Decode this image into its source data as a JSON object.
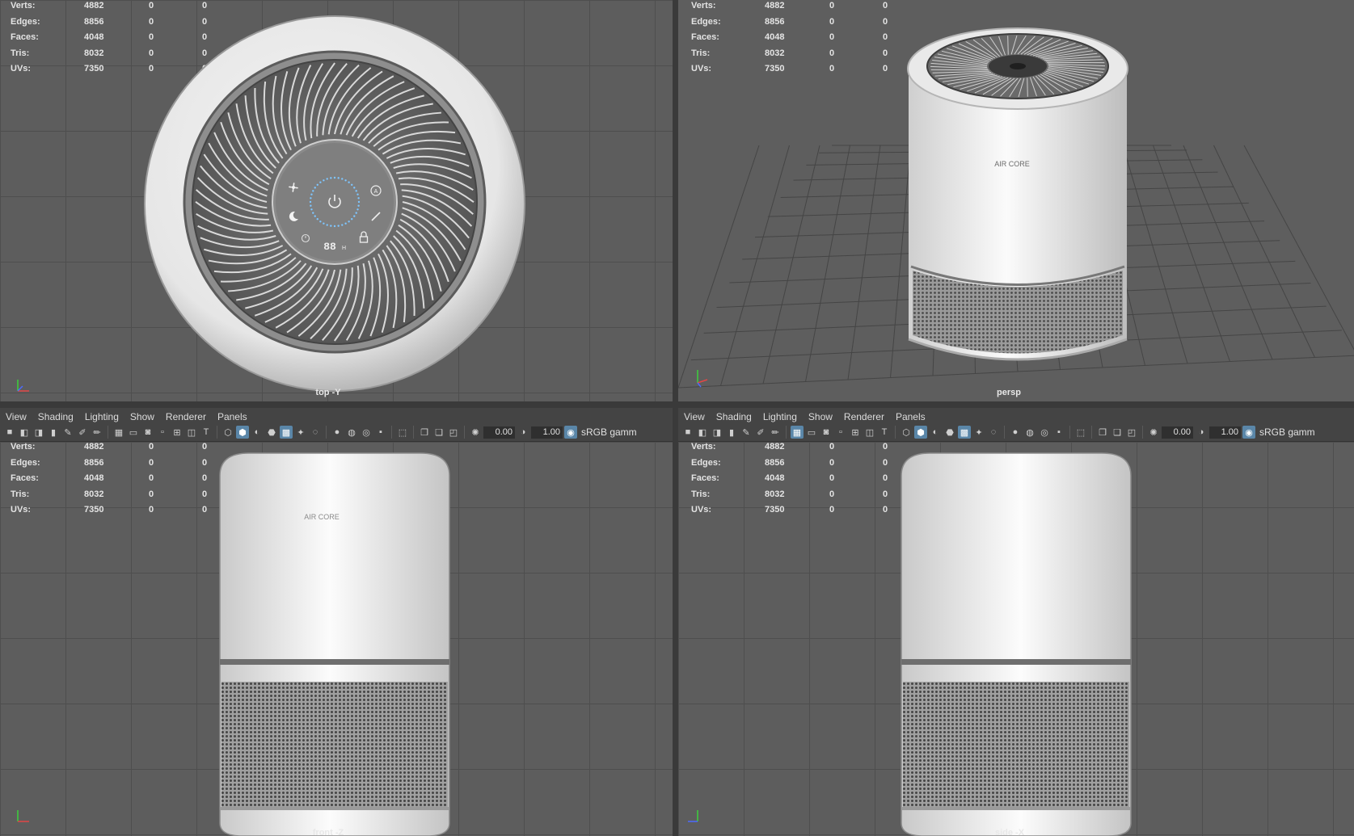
{
  "stats": {
    "rows": [
      {
        "label": "Verts:",
        "v1": "4882",
        "v2": "0",
        "v3": "0"
      },
      {
        "label": "Edges:",
        "v1": "8856",
        "v2": "0",
        "v3": "0"
      },
      {
        "label": "Faces:",
        "v1": "4048",
        "v2": "0",
        "v3": "0"
      },
      {
        "label": "Tris:",
        "v1": "8032",
        "v2": "0",
        "v3": "0"
      },
      {
        "label": "UVs:",
        "v1": "7350",
        "v2": "0",
        "v3": "0"
      }
    ]
  },
  "menu": {
    "view": "View",
    "shading": "Shading",
    "lighting": "Lighting",
    "show": "Show",
    "renderer": "Renderer",
    "panels": "Panels"
  },
  "toolbar": {
    "exposure": "0.00",
    "gamma": "1.00",
    "color_space": "sRGB gamm"
  },
  "cameras": {
    "top": "top -Y",
    "persp": "persp",
    "front": "front -Z",
    "side": "side -X"
  },
  "product": {
    "brand": "AIR CORE",
    "display_digits": "88",
    "display_unit": "H"
  },
  "icons": {
    "fan": "fan-icon",
    "power": "power-icon",
    "auto": "auto-icon",
    "sleep": "moon-icon",
    "timer": "timer-icon",
    "lock": "lock-icon",
    "filter": "filter-icon"
  },
  "colors": {
    "viewport_bg": "#5d5d5d",
    "panel_bg": "#444444",
    "toggle_on": "#5a86a8",
    "led": "#7ec6ff"
  }
}
